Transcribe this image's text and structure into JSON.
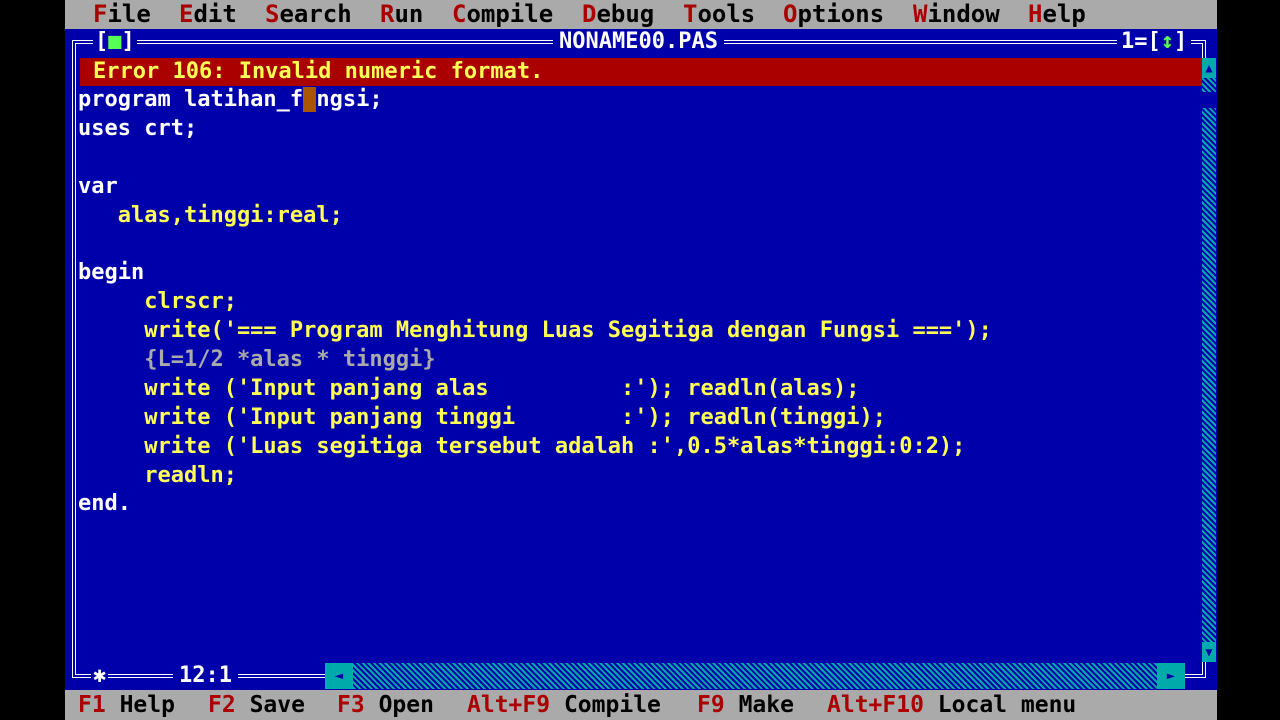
{
  "menu": [
    {
      "hot": "F",
      "rest": "ile"
    },
    {
      "hot": "E",
      "rest": "dit"
    },
    {
      "hot": "S",
      "rest": "earch"
    },
    {
      "hot": "R",
      "rest": "un"
    },
    {
      "hot": "C",
      "rest": "ompile"
    },
    {
      "hot": "D",
      "rest": "ebug"
    },
    {
      "hot": "T",
      "rest": "ools"
    },
    {
      "hot": "O",
      "rest": "ptions"
    },
    {
      "hot": "W",
      "rest": "indow"
    },
    {
      "hot": "H",
      "rest": "elp"
    }
  ],
  "window": {
    "title": "NONAME00.PAS",
    "close_box": "[■]",
    "number": "1",
    "zoom_box": "[↕]",
    "cursor_position": "12:1"
  },
  "error": {
    "message": "Error 106: Invalid numeric format."
  },
  "code": {
    "line1_before": "program latihan_f",
    "line1_cursor": "u",
    "line1_after": "ngsi;",
    "line2": "uses crt;",
    "line3": "",
    "line4": "var",
    "line5": "   alas,tinggi:real;",
    "line6": "",
    "line7": "begin",
    "line8": "     clrscr;",
    "line9": "     write('=== Program Menghitung Luas Segitiga dengan Fungsi ===');",
    "line10": "     {L=1/2 *alas * tinggi}",
    "line11": "     write ('Input panjang alas          :'); readln(alas);",
    "line12": "     write ('Input panjang tinggi        :'); readln(tinggi);",
    "line13": "     write ('Luas segitiga tersebut adalah :',0.5*alas*tinggi:0:2);",
    "line14": "     readln;",
    "line15": "end."
  },
  "fkeys": [
    {
      "key": "F1",
      "label": "Help"
    },
    {
      "key": "F2",
      "label": "Save"
    },
    {
      "key": "F3",
      "label": "Open"
    },
    {
      "key": "Alt+F9",
      "label": "Compile"
    },
    {
      "key": "F9",
      "label": "Make"
    },
    {
      "key": "Alt+F10",
      "label": "Local menu"
    }
  ],
  "colors": {
    "background": "#0000aa",
    "menu_bg": "#aaaaaa",
    "hotkey": "#aa0000",
    "code_text": "#ffff55",
    "comment": "#aaaaaa",
    "error_bg": "#aa0000",
    "error_text": "#ffff55"
  },
  "icons": {
    "close": "close-box-icon",
    "zoom": "zoom-arrows-icon",
    "scroll_up": "arrow-up-icon",
    "scroll_down": "arrow-down-icon",
    "scroll_left": "arrow-left-icon",
    "scroll_right": "arrow-right-icon",
    "modified": "modified-star-icon"
  }
}
